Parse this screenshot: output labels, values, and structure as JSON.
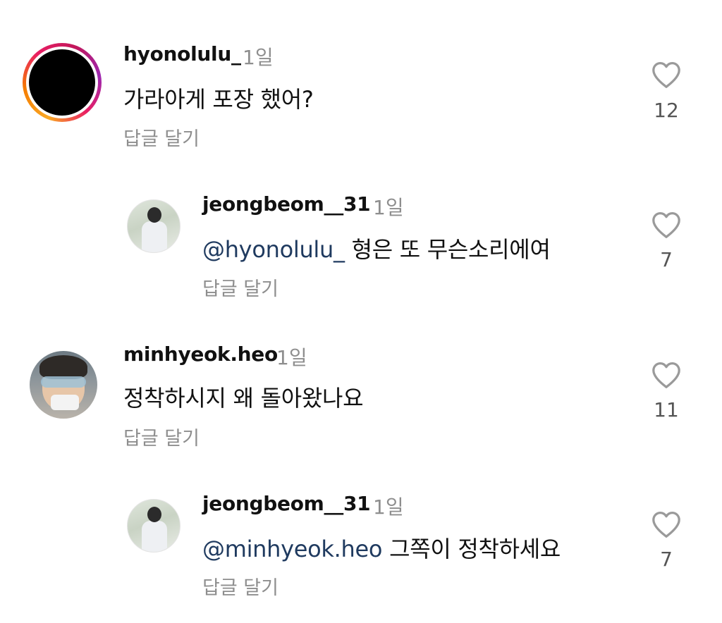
{
  "comments": [
    {
      "username": "hyonolulu_",
      "time": "1일",
      "mention": "",
      "text": "가라아게 포장 했어?",
      "reply_label": "답글 달기",
      "like_count": "12"
    },
    {
      "username": "jeongbeom__31",
      "time": "1일",
      "mention": "@hyonolulu_",
      "text": "형은 또 무슨소리에여",
      "reply_label": "답글 달기",
      "like_count": "7"
    },
    {
      "username": "minhyeok.heo",
      "time": "1일",
      "mention": "",
      "text": "정착하시지 왜 돌아왔나요",
      "reply_label": "답글 달기",
      "like_count": "11"
    },
    {
      "username": "jeongbeom__31",
      "time": "1일",
      "mention": "@minhyeok.heo",
      "text": "그쪽이 정착하세요",
      "reply_label": "답글 달기",
      "like_count": "7"
    }
  ],
  "icons": {
    "like": "heart-outline-icon"
  },
  "colors": {
    "mention": "#1f3a5f",
    "muted": "#8e8e8e",
    "story_ring": [
      "#f9a825",
      "#e91e63",
      "#9c27b0"
    ]
  }
}
